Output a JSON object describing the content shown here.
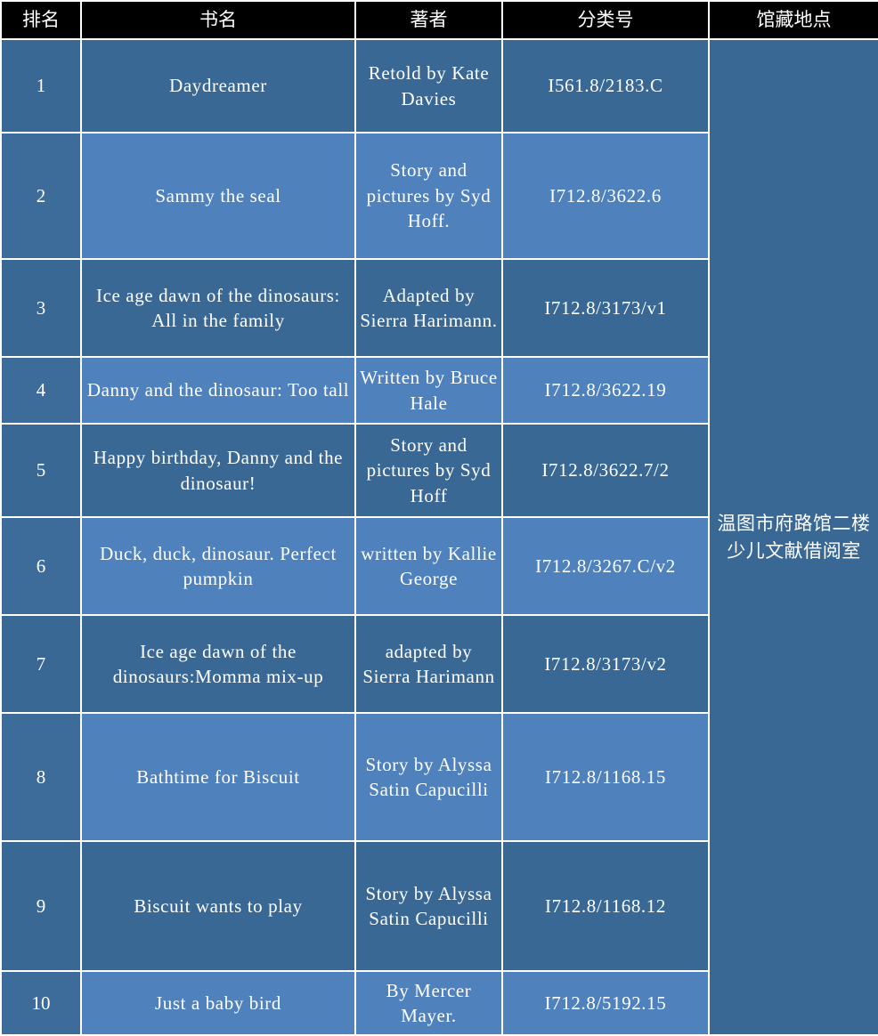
{
  "table": {
    "headers": [
      {
        "key": "rank",
        "label": "排名"
      },
      {
        "key": "title",
        "label": "书名"
      },
      {
        "key": "author",
        "label": "著者"
      },
      {
        "key": "class",
        "label": "分类号"
      },
      {
        "key": "loc",
        "label": "馆藏地点"
      }
    ],
    "location_value": "温图市府路馆二楼少儿文献借阅室",
    "rows": [
      {
        "rank": "1",
        "title": "Daydreamer",
        "author": "Retold by Kate Davies",
        "class": "I561.8/2183.C",
        "shade": "dark"
      },
      {
        "rank": "2",
        "title": "Sammy the seal",
        "author": "Story and pictures by Syd Hoff.",
        "class": "I712.8/3622.6",
        "shade": "light"
      },
      {
        "rank": "3",
        "title": "Ice age dawn of the dinosaurs: All in the family",
        "author": "Adapted by Sierra Harimann.",
        "class": "I712.8/3173/v1",
        "shade": "dark"
      },
      {
        "rank": "4",
        "title": "Danny and the dinosaur: Too tall",
        "author": "Written by Bruce Hale",
        "class": "I712.8/3622.19",
        "shade": "light"
      },
      {
        "rank": "5",
        "title": "Happy birthday, Danny and the dinosaur!",
        "author": "Story and pictures by Syd Hoff",
        "class": "I712.8/3622.7/2",
        "shade": "dark"
      },
      {
        "rank": "6",
        "title": "Duck, duck, dinosaur. Perfect pumpkin",
        "author": "written by Kallie George",
        "class": "I712.8/3267.C/v2",
        "shade": "light"
      },
      {
        "rank": "7",
        "title": "Ice age dawn of the dinosaurs:Momma mix-up",
        "author": "adapted by Sierra Harimann",
        "class": "I712.8/3173/v2",
        "shade": "dark"
      },
      {
        "rank": "8",
        "title": "Bathtime for Biscuit",
        "author": "Story by Alyssa Satin Capucilli",
        "class": "I712.8/1168.15",
        "shade": "light"
      },
      {
        "rank": "9",
        "title": "Biscuit wants to play",
        "author": "Story by Alyssa Satin Capucilli",
        "class": "I712.8/1168.12",
        "shade": "dark"
      },
      {
        "rank": "10",
        "title": "Just a baby bird",
        "author": "By Mercer Mayer.",
        "class": "I712.8/5192.15",
        "shade": "light"
      }
    ]
  },
  "colors": {
    "header_bg": "#000000",
    "header_fg": "#ffffff",
    "row_dark": "#3A6895",
    "row_light": "#4F81BD",
    "rank_dark": "#3A6895",
    "rank_light": "#3E6C9A",
    "grid": "#ffffff"
  }
}
